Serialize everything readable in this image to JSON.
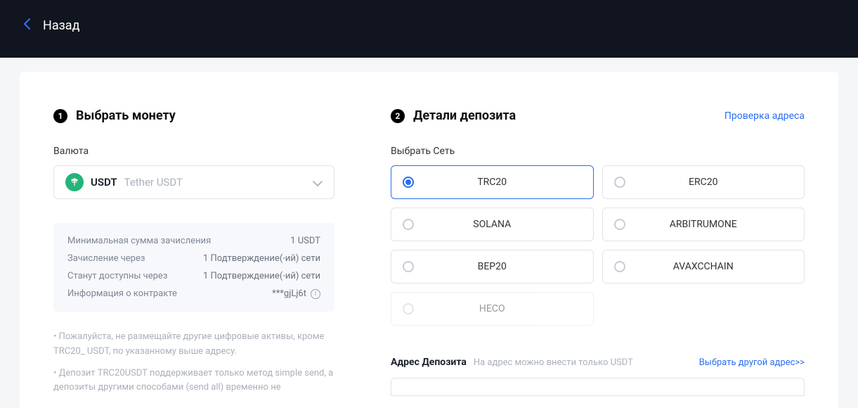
{
  "topbar": {
    "back_label": "Назад"
  },
  "step1": {
    "title": "Выбрать монету",
    "currency_label": "Валюта",
    "coin_code": "USDT",
    "coin_name": "Tether USDT"
  },
  "info": {
    "rows": [
      {
        "label": "Минимальная сумма зачисления",
        "value": "1 USDT"
      },
      {
        "label": "Зачисление через",
        "value": "1 Подтверждение(-ий) сети"
      },
      {
        "label": "Станут доступны через",
        "value": "1 Подтверждение(-ий) сети"
      },
      {
        "label": "Информация о контракте",
        "value": "***gjLj6t",
        "has_info": true
      }
    ]
  },
  "notes": {
    "line1": "• Пожалуйста, не размещайте другие цифровые активы, кроме TRC20_ USDT, по указанному выше адресу.",
    "line2": "• Депозит TRC20USDT поддерживает только метод simple send, а депозиты другими способами (send all) временно не"
  },
  "step2": {
    "title": "Детали депозита",
    "check_link": "Проверка адреса",
    "network_label": "Выбрать Сеть",
    "networks": [
      {
        "label": "TRC20",
        "selected": true,
        "disabled": false
      },
      {
        "label": "ERC20",
        "selected": false,
        "disabled": false
      },
      {
        "label": "SOLANA",
        "selected": false,
        "disabled": false
      },
      {
        "label": "ARBITRUMONE",
        "selected": false,
        "disabled": false
      },
      {
        "label": "BEP20",
        "selected": false,
        "disabled": false
      },
      {
        "label": "AVAXCCHAIN",
        "selected": false,
        "disabled": false
      },
      {
        "label": "HECO",
        "selected": false,
        "disabled": true
      }
    ]
  },
  "address": {
    "title": "Адрес Депозита",
    "hint": "На адрес можно внести только USDT",
    "other_link": "Выбрать другой адрес>>"
  }
}
